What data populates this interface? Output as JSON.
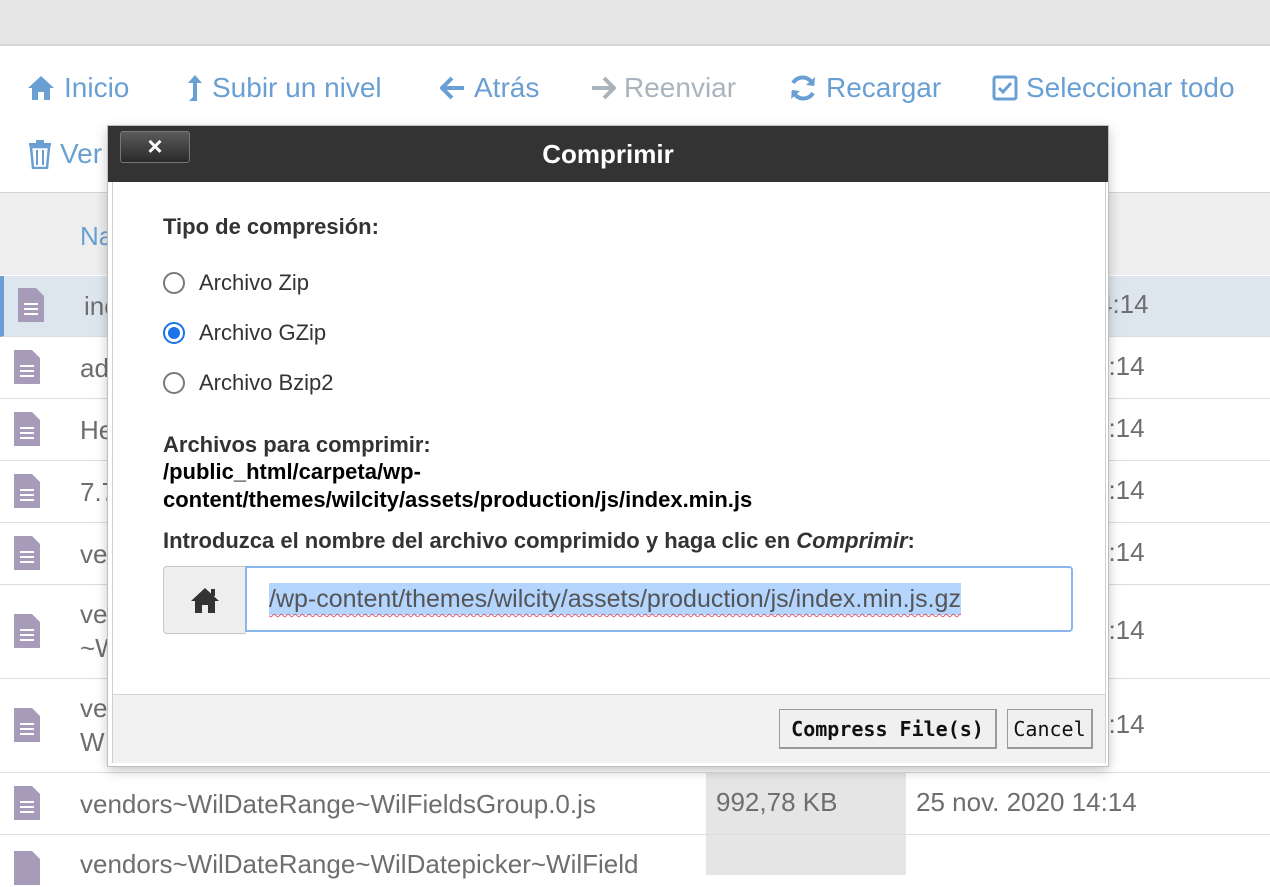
{
  "toolbar": {
    "items": [
      {
        "label": "Inicio",
        "icon": "home-icon"
      },
      {
        "label": "Subir un nivel",
        "icon": "level-up-icon"
      },
      {
        "label": "Atrás",
        "icon": "arrow-left-icon"
      },
      {
        "label": "Reenviar",
        "icon": "arrow-right-icon",
        "disabled": true
      },
      {
        "label": "Recargar",
        "icon": "refresh-icon"
      },
      {
        "label": "Seleccionar todo",
        "icon": "checkbox-icon"
      }
    ],
    "row2_partial_label": "Ver"
  },
  "file_list": {
    "header_name_partial": "Na",
    "rows": [
      {
        "name": "inc",
        "time": "4:14",
        "selected": true
      },
      {
        "name": "ad",
        "time": "4:14"
      },
      {
        "name": "He",
        "time": "4:14"
      },
      {
        "name": "7.7",
        "time": "4:14"
      },
      {
        "name": "ve",
        "time": "4:14"
      },
      {
        "name": "ve",
        "name2": "~W",
        "time": "4:14"
      },
      {
        "name": "ve",
        "name2": "W",
        "time": "4:14"
      },
      {
        "name": "vendors~WilDateRange~WilFieldsGroup.0.js",
        "size": "992,78 KB",
        "date": "25 nov. 2020 14:14"
      },
      {
        "name": "vendors~WilDateRange~WilDatepicker~WilField"
      }
    ]
  },
  "dialog": {
    "title": "Comprimir",
    "close_label": "×",
    "compression_type_label": "Tipo de compresión:",
    "options": [
      {
        "label": "Archivo Zip",
        "checked": false
      },
      {
        "label": "Archivo GZip",
        "checked": true
      },
      {
        "label": "Archivo Bzip2",
        "checked": false
      }
    ],
    "files_label": "Archivos para comprimir:",
    "file_path_line1": "/public_html/carpeta/wp-",
    "file_path_line2": "content/themes/wilcity/assets/production/js/index.min.js",
    "instruction_prefix": "Introduzca el nombre del archivo comprimido y haga clic en ",
    "instruction_emphasis": "Comprimir",
    "instruction_suffix": ":",
    "archive_name_value": "/wp-content/themes/wilcity/assets/production/js/index.min.js.gz",
    "compress_button": "Compress File(s)",
    "cancel_button": "Cancel"
  },
  "colors": {
    "link": "#6a9fd4",
    "dialog_header": "#333333",
    "radio_checked": "#1a73e8",
    "file_icon": "#a69bb8"
  }
}
